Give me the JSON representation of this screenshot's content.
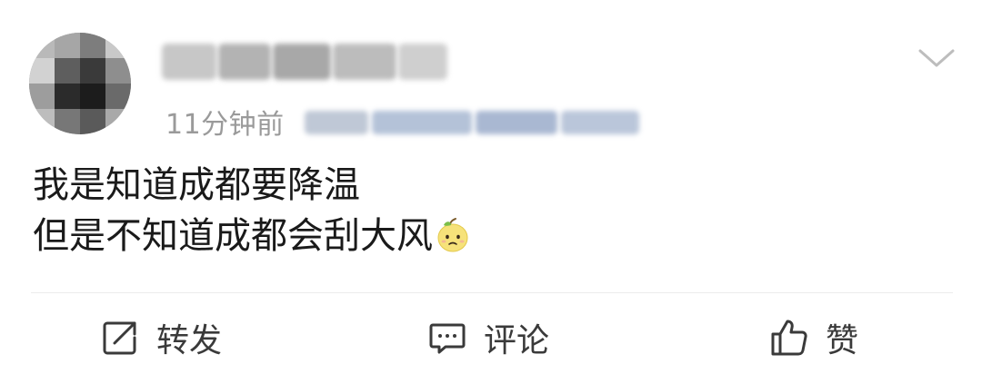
{
  "post": {
    "time_text": "11分钟前",
    "content_lines": [
      "我是知道成都要降温",
      "但是不知道成都会刮大风"
    ],
    "emoji": "pear-face-emoji"
  },
  "actions": {
    "repost_label": "转发",
    "comment_label": "评论",
    "like_label": "赞"
  },
  "icons": {
    "more": "chevron-down-icon",
    "repost": "share-icon",
    "comment": "comment-icon",
    "like": "thumbs-up-icon"
  },
  "colors": {
    "text": "#1a1a1a",
    "muted": "#9a9a9a",
    "icon": "#3a3a3a",
    "divider": "#ececec"
  }
}
